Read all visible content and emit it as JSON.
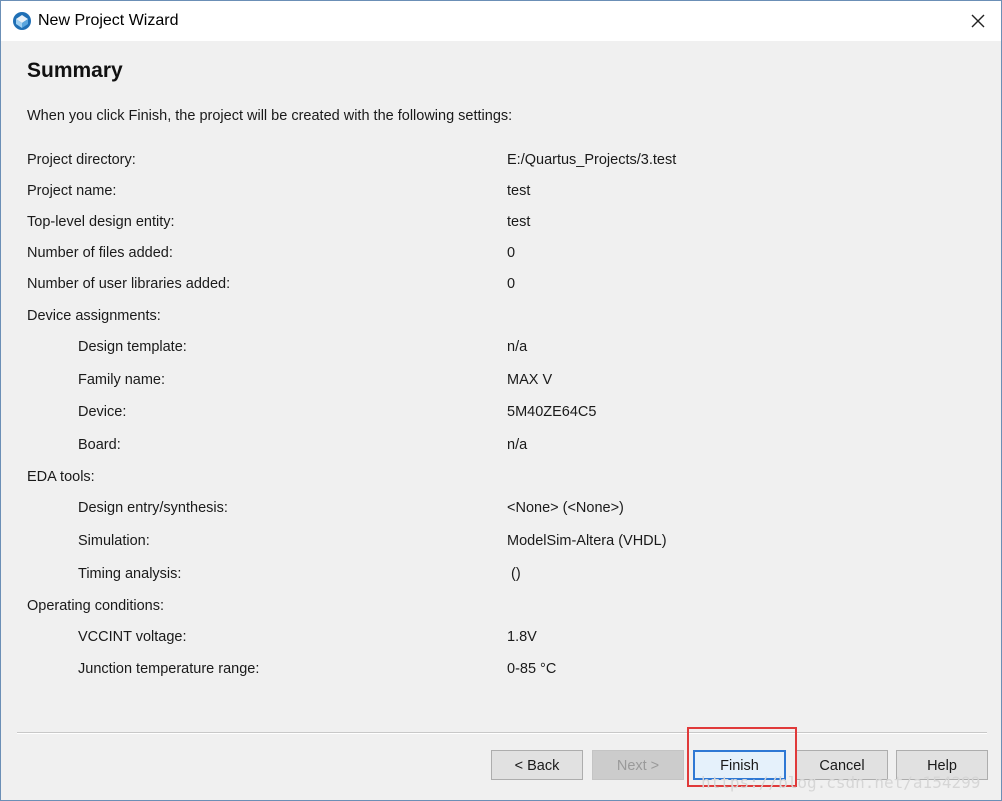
{
  "window": {
    "title": "New Project Wizard"
  },
  "page": {
    "title": "Summary",
    "intro": "When you click Finish, the project will be created with the following settings:"
  },
  "settings": [
    {
      "label": "Project directory:",
      "value": "E:/Quartus_Projects/3.test"
    },
    {
      "label": "Project name:",
      "value": "test"
    },
    {
      "label": "Top-level design entity:",
      "value": "test"
    },
    {
      "label": "Number of files added:",
      "value": "0"
    },
    {
      "label": "Number of user libraries added:",
      "value": "0"
    },
    {
      "label": "Device assignments:",
      "value": ""
    },
    {
      "label": "Design template:",
      "value": "n/a"
    },
    {
      "label": "Family name:",
      "value": "MAX V"
    },
    {
      "label": "Device:",
      "value": "5M40ZE64C5"
    },
    {
      "label": "Board:",
      "value": "n/a"
    },
    {
      "label": "EDA tools:",
      "value": ""
    },
    {
      "label": "Design entry/synthesis:",
      "value": "<None> (<None>)"
    },
    {
      "label": "Simulation:",
      "value": "ModelSim-Altera (VHDL)"
    },
    {
      "label": "Timing analysis:",
      "value": " ()"
    },
    {
      "label": "Operating conditions:",
      "value": ""
    },
    {
      "label": "VCCINT voltage:",
      "value": "1.8V"
    },
    {
      "label": "Junction temperature range:",
      "value": "0-85 °C"
    }
  ],
  "buttons": {
    "back": "< Back",
    "next": "Next >",
    "finish": "Finish",
    "cancel": "Cancel",
    "help": "Help"
  },
  "watermark": "https://blog.csdn.net/a154299",
  "colors": {
    "highlight": "#e03a3a",
    "accent": "#2e78d4"
  }
}
